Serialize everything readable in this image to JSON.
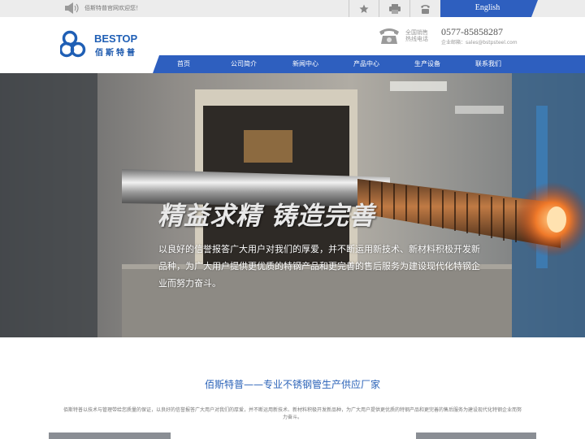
{
  "topbar": {
    "welcome": "佰斯特普官网欢迎您！",
    "language": "English",
    "icons": [
      "speaker-icon",
      "star-icon",
      "printer-icon",
      "phone-icon"
    ]
  },
  "header": {
    "logo_word": "BESTOP",
    "logo_cn": "佰斯特普",
    "hotline_label_1": "全国销售",
    "hotline_label_2": "热线电话",
    "phone": "0577-85858287",
    "email_label": "企业邮箱：sales@bstpsteel.com"
  },
  "nav": {
    "items": [
      "首页",
      "公司简介",
      "新闻中心",
      "产品中心",
      "生产设备",
      "联系我们"
    ]
  },
  "banner": {
    "slogan": "精益求精  铸造完善",
    "description": "以良好的信誉报答广大用户对我们的厚爱，并不断运用新技术、新材料积极开发新品种，为广大用户提供更优质的特钢产品和更完善的售后服务为建设现代化特钢企业而努力奋斗。"
  },
  "intro": {
    "title": "佰斯特普——专业不锈钢管生产供应厂家",
    "text": "佰斯特普以技术与管理带给您质量的保证，以良好的信誉报答广大用户对我们的厚爱，并不断运用新技术、新材料积极开发新品种，为广大用户提供更优质的特钢产品和更完善的售后服务为建设现代化特钢企业而努力奋斗。"
  },
  "colors": {
    "brand_blue": "#1f5fb5",
    "nav_blue": "#2e5fbf",
    "topbar_gray": "#ececec"
  }
}
